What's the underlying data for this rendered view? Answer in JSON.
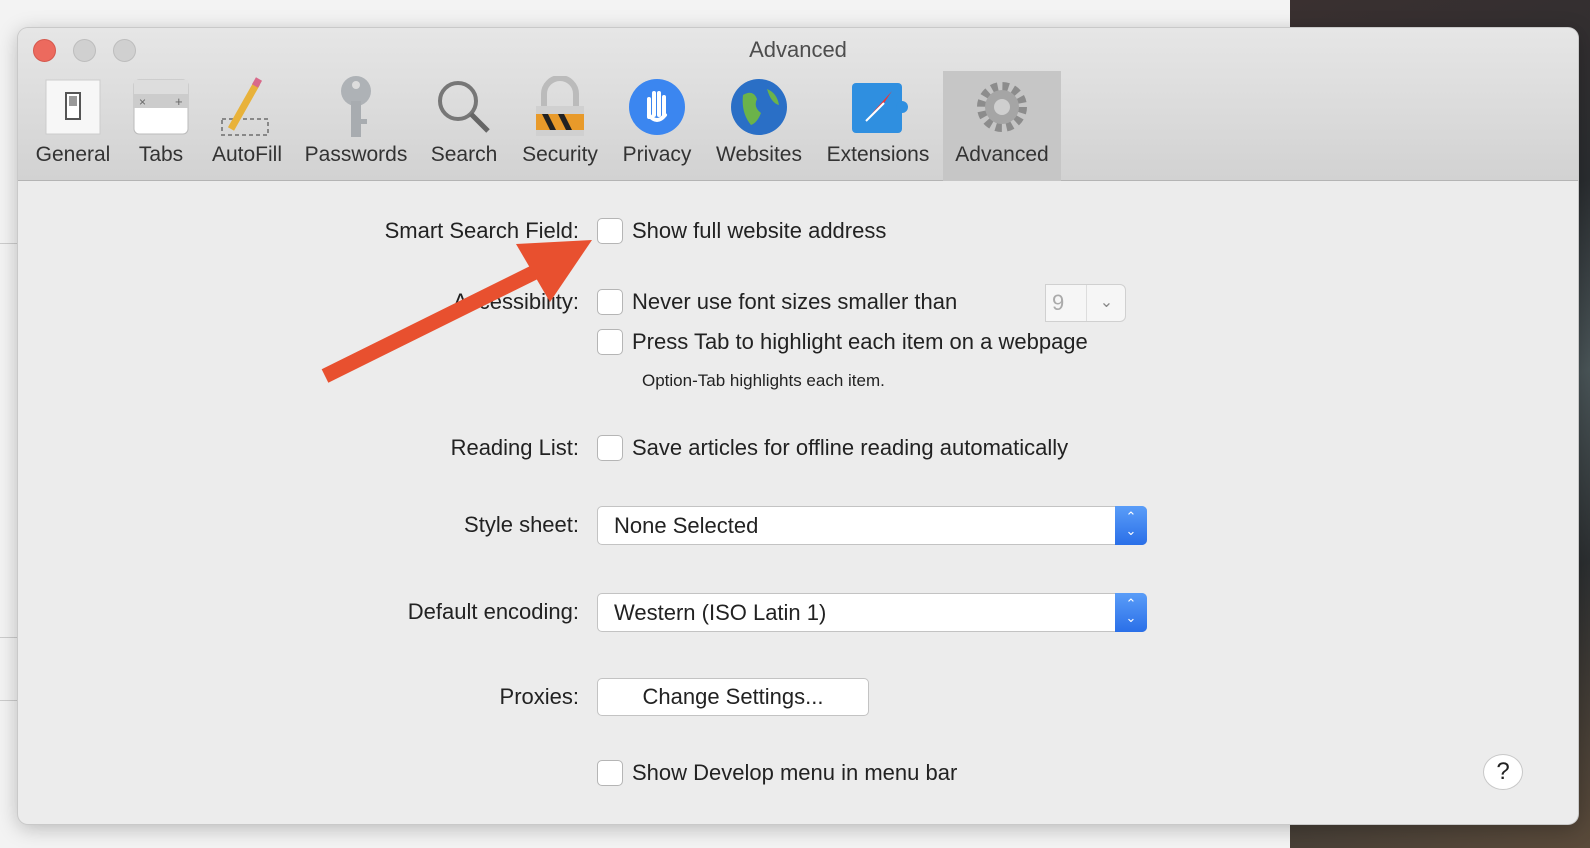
{
  "window": {
    "title": "Advanced"
  },
  "toolbar": {
    "items": [
      {
        "label": "General",
        "icon": "general-switch-icon"
      },
      {
        "label": "Tabs",
        "icon": "tabs-icon"
      },
      {
        "label": "AutoFill",
        "icon": "pencil-icon"
      },
      {
        "label": "Passwords",
        "icon": "key-icon"
      },
      {
        "label": "Search",
        "icon": "magnifier-icon"
      },
      {
        "label": "Security",
        "icon": "padlock-icon"
      },
      {
        "label": "Privacy",
        "icon": "hand-icon"
      },
      {
        "label": "Websites",
        "icon": "globe-icon"
      },
      {
        "label": "Extensions",
        "icon": "puzzle-compass-icon"
      },
      {
        "label": "Advanced",
        "icon": "gear-icon",
        "selected": true
      }
    ]
  },
  "settings": {
    "smart_search": {
      "label": "Smart Search Field:",
      "option": "Show full website address",
      "checked": false
    },
    "accessibility": {
      "label": "Accessibility:",
      "option1": "Never use font sizes smaller than",
      "font_size": "9",
      "option2": "Press Tab to highlight each item on a webpage",
      "hint": "Option-Tab highlights each item.",
      "checked1": false,
      "checked2": false
    },
    "reading_list": {
      "label": "Reading List:",
      "option": "Save articles for offline reading automatically",
      "checked": false
    },
    "style_sheet": {
      "label": "Style sheet:",
      "value": "None Selected"
    },
    "encoding": {
      "label": "Default encoding:",
      "value": "Western (ISO Latin 1)"
    },
    "proxies": {
      "label": "Proxies:",
      "button": "Change Settings..."
    },
    "develop": {
      "option": "Show Develop menu in menu bar",
      "checked": false
    }
  },
  "help": {
    "label": "?"
  },
  "annotation": {
    "arrow_color": "#E8502F"
  }
}
